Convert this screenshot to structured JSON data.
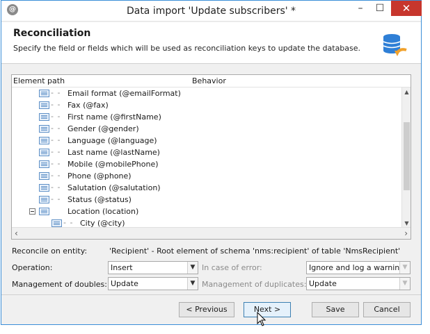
{
  "window": {
    "title": "Data import 'Update subscribers' *",
    "controls": {
      "minimize": "–",
      "maximize": "☐",
      "close": "✕"
    }
  },
  "header": {
    "title": "Reconciliation",
    "description": "Specify the field or fields which will be used as reconciliation keys to update the database.",
    "icon": "database-refresh-icon"
  },
  "tree": {
    "columns": [
      "Element path",
      "Behavior"
    ],
    "rows": [
      {
        "label": "Email format (@emailFormat)"
      },
      {
        "label": "Fax (@fax)"
      },
      {
        "label": "First name (@firstName)"
      },
      {
        "label": "Gender (@gender)"
      },
      {
        "label": "Language (@language)"
      },
      {
        "label": "Last name (@lastName)"
      },
      {
        "label": "Mobile (@mobilePhone)"
      },
      {
        "label": "Phone (@phone)"
      },
      {
        "label": "Salutation (@salutation)"
      },
      {
        "label": "Status (@status)"
      },
      {
        "label": "Location (location)"
      },
      {
        "label": "City (@city)"
      }
    ]
  },
  "reconcile": {
    "label": "Reconcile on entity:",
    "value": "'Recipient' - Root element of schema 'nms:recipient' of table 'NmsRecipient'"
  },
  "operation": {
    "label": "Operation:",
    "value": "Insert",
    "error_label": "In case of error:",
    "error_value": "Ignore and log a warning"
  },
  "doubles": {
    "label": "Management of doubles:",
    "value": "Update",
    "duplicates_label": "Management of duplicates:",
    "duplicates_value": "Update"
  },
  "buttons": {
    "previous": "< Previous",
    "next": "Next >",
    "save": "Save",
    "cancel": "Cancel"
  }
}
